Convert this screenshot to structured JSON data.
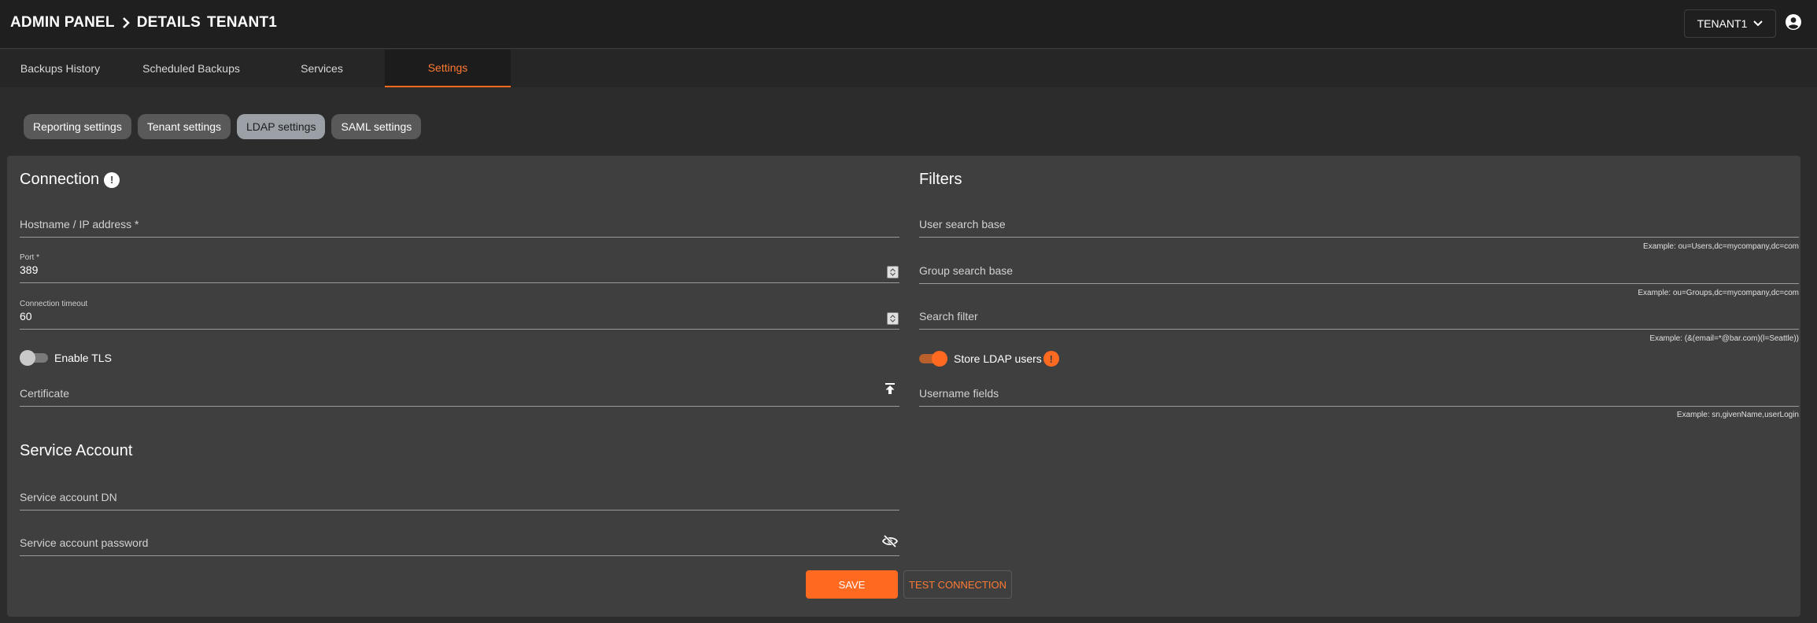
{
  "header": {
    "breadcrumb_root": "ADMIN PANEL",
    "breadcrumb_page": "DETAILS",
    "breadcrumb_tenant": "TENANT1",
    "tenant_selector": "TENANT1"
  },
  "tabs": [
    {
      "label": "Backups History"
    },
    {
      "label": "Scheduled Backups"
    },
    {
      "label": "Services"
    },
    {
      "label": "Settings"
    }
  ],
  "subtabs": [
    {
      "label": "Reporting settings"
    },
    {
      "label": "Tenant settings"
    },
    {
      "label": "LDAP settings"
    },
    {
      "label": "SAML settings"
    }
  ],
  "connection": {
    "title": "Connection",
    "hostname_placeholder": "Hostname / IP address *",
    "port_label": "Port *",
    "port_value": "389",
    "timeout_label": "Connection timeout",
    "timeout_value": "60",
    "enable_tls_label": "Enable TLS",
    "certificate_placeholder": "Certificate"
  },
  "service_account": {
    "title": "Service Account",
    "dn_placeholder": "Service account DN",
    "password_placeholder": "Service account password"
  },
  "filters": {
    "title": "Filters",
    "user_search_base_placeholder": "User search base",
    "user_search_base_helper": "Example: ou=Users,dc=mycompany,dc=com",
    "group_search_base_placeholder": "Group search base",
    "group_search_base_helper": "Example: ou=Groups,dc=mycompany,dc=com",
    "search_filter_placeholder": "Search filter",
    "search_filter_helper": "Example: (&(email=*@bar.com)(l=Seattle))",
    "store_ldap_users_label": "Store LDAP users",
    "username_fields_placeholder": "Username fields",
    "username_fields_helper": "Example: sn,givenName,userLogin"
  },
  "actions": {
    "save": "SAVE",
    "test_connection": "TEST CONNECTION"
  },
  "colors": {
    "accent": "#ff6a20",
    "background": "#2c2c2c",
    "card": "#3f3f3f"
  }
}
